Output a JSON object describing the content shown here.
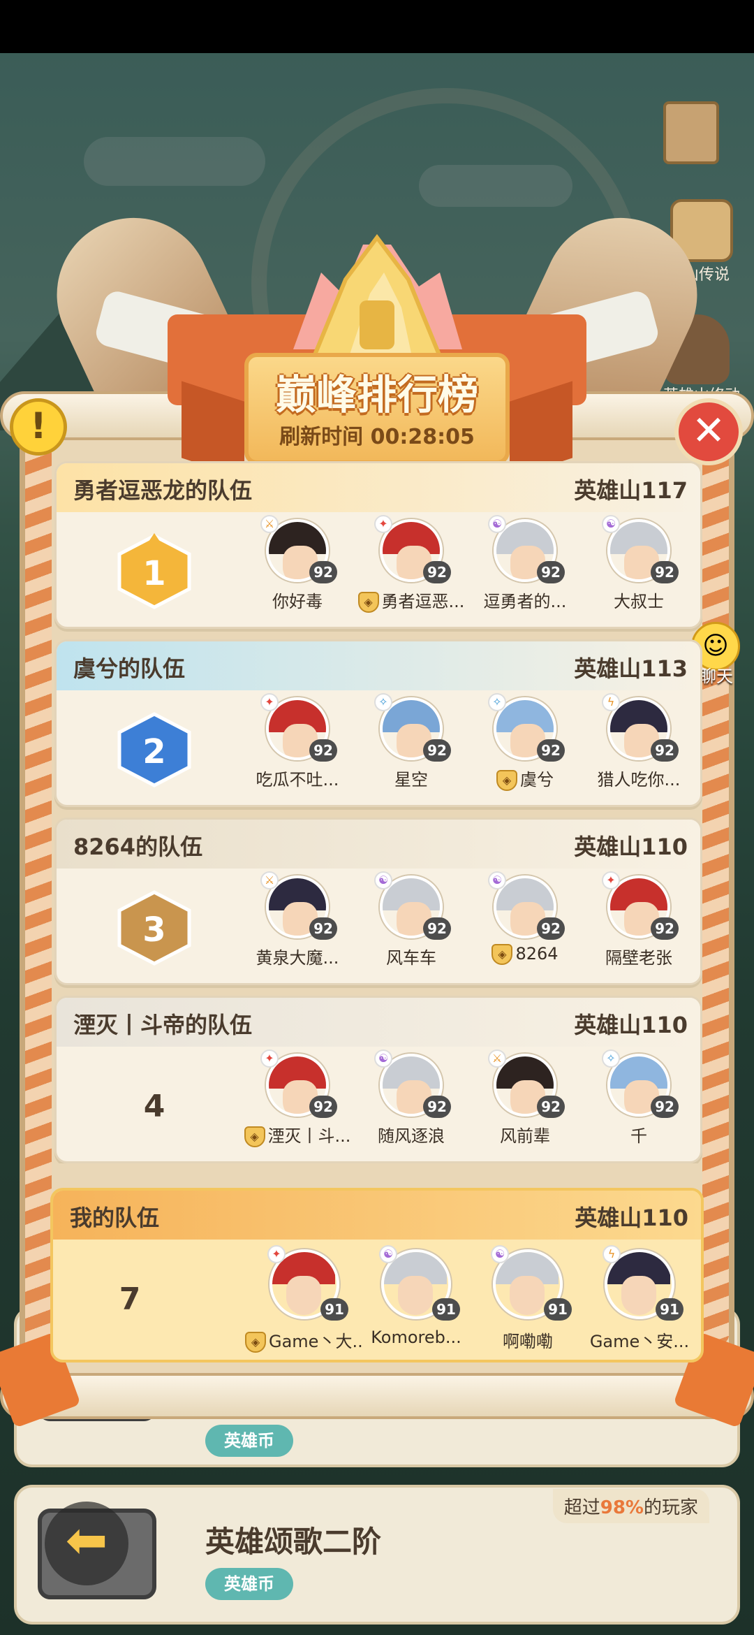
{
  "title": "巅峰排行榜",
  "refresh_time": "刷新时间 00:28:05",
  "side": {
    "legend_label": "山传说",
    "caveman_label": "英雄山修动",
    "chat_label": "聊天"
  },
  "teams": [
    {
      "name": "勇者逗恶龙的队伍",
      "level": "英雄山117",
      "rank": "1",
      "members": [
        {
          "name": "你好毒",
          "level": "92",
          "element": "sword",
          "hair": "#2d2320",
          "leader": false
        },
        {
          "name": "勇者逗恶...",
          "level": "92",
          "element": "fire",
          "hair": "#c7302c",
          "leader": true
        },
        {
          "name": "逗勇者的...",
          "level": "92",
          "element": "wind",
          "hair": "#c9cdd3",
          "leader": false
        },
        {
          "name": "大叔士",
          "level": "92",
          "element": "wind",
          "hair": "#c9cdd3",
          "leader": false
        }
      ]
    },
    {
      "name": "虞兮的队伍",
      "level": "英雄山113",
      "rank": "2",
      "members": [
        {
          "name": "吃瓜不吐...",
          "level": "92",
          "element": "fire",
          "hair": "#c7302c",
          "leader": false
        },
        {
          "name": "星空",
          "level": "92",
          "element": "water",
          "hair": "#7aa6d6",
          "leader": false
        },
        {
          "name": "虞兮",
          "level": "92",
          "element": "water",
          "hair": "#8fb6df",
          "leader": true
        },
        {
          "name": "猎人吃你...",
          "level": "92",
          "element": "bolt",
          "hair": "#2d2a40",
          "leader": false
        }
      ]
    },
    {
      "name": "8264的队伍",
      "level": "英雄山110",
      "rank": "3",
      "members": [
        {
          "name": "黄泉大魔...",
          "level": "92",
          "element": "sword",
          "hair": "#2d2a40",
          "leader": false
        },
        {
          "name": "风车车",
          "level": "92",
          "element": "wind",
          "hair": "#c9cdd3",
          "leader": false
        },
        {
          "name": "8264",
          "level": "92",
          "element": "wind",
          "hair": "#c9cdd3",
          "leader": true
        },
        {
          "name": "隔壁老张",
          "level": "92",
          "element": "fire",
          "hair": "#c7302c",
          "leader": false
        }
      ]
    },
    {
      "name": "湮灭丨斗帝的队伍",
      "level": "英雄山110",
      "rank": "4",
      "members": [
        {
          "name": "湮灭丨斗...",
          "level": "92",
          "element": "fire",
          "hair": "#c7302c",
          "leader": true
        },
        {
          "name": "随风逐浪",
          "level": "92",
          "element": "wind",
          "hair": "#c9cdd3",
          "leader": false
        },
        {
          "name": "风前辈",
          "level": "92",
          "element": "sword",
          "hair": "#2d2320",
          "leader": false
        },
        {
          "name": "千",
          "level": "92",
          "element": "water",
          "hair": "#8fb6df",
          "leader": false
        }
      ]
    }
  ],
  "my_team": {
    "name": "我的队伍",
    "level": "英雄山110",
    "rank": "7",
    "members": [
      {
        "name": "Game丶大...",
        "level": "91",
        "element": "fire",
        "hair": "#c7302c",
        "leader": true
      },
      {
        "name": "Komoreb...",
        "level": "91",
        "element": "wind",
        "hair": "#c9cdd3",
        "leader": false
      },
      {
        "name": "啊嘞嘞",
        "level": "91",
        "element": "wind",
        "hair": "#c9cdd3",
        "leader": false
      },
      {
        "name": "Game丶安...",
        "level": "91",
        "element": "bolt",
        "hair": "#2d2a40",
        "leader": false
      }
    ]
  },
  "bg_cards": [
    {
      "title": "",
      "coin_label": "英雄币"
    },
    {
      "title": "英雄颂歌二阶",
      "coin_label": "英雄币",
      "pct_prefix": "超过",
      "pct_value": "98%",
      "pct_suffix": "的玩家"
    }
  ],
  "colors": {
    "banner": "#e2703a",
    "plaque": "#f2b85a",
    "card": "#f8f1e3",
    "my_card": "#fde8b1",
    "rank1": "#f4b63a",
    "rank2": "#3d7fd6",
    "rank3": "#c9954e"
  }
}
